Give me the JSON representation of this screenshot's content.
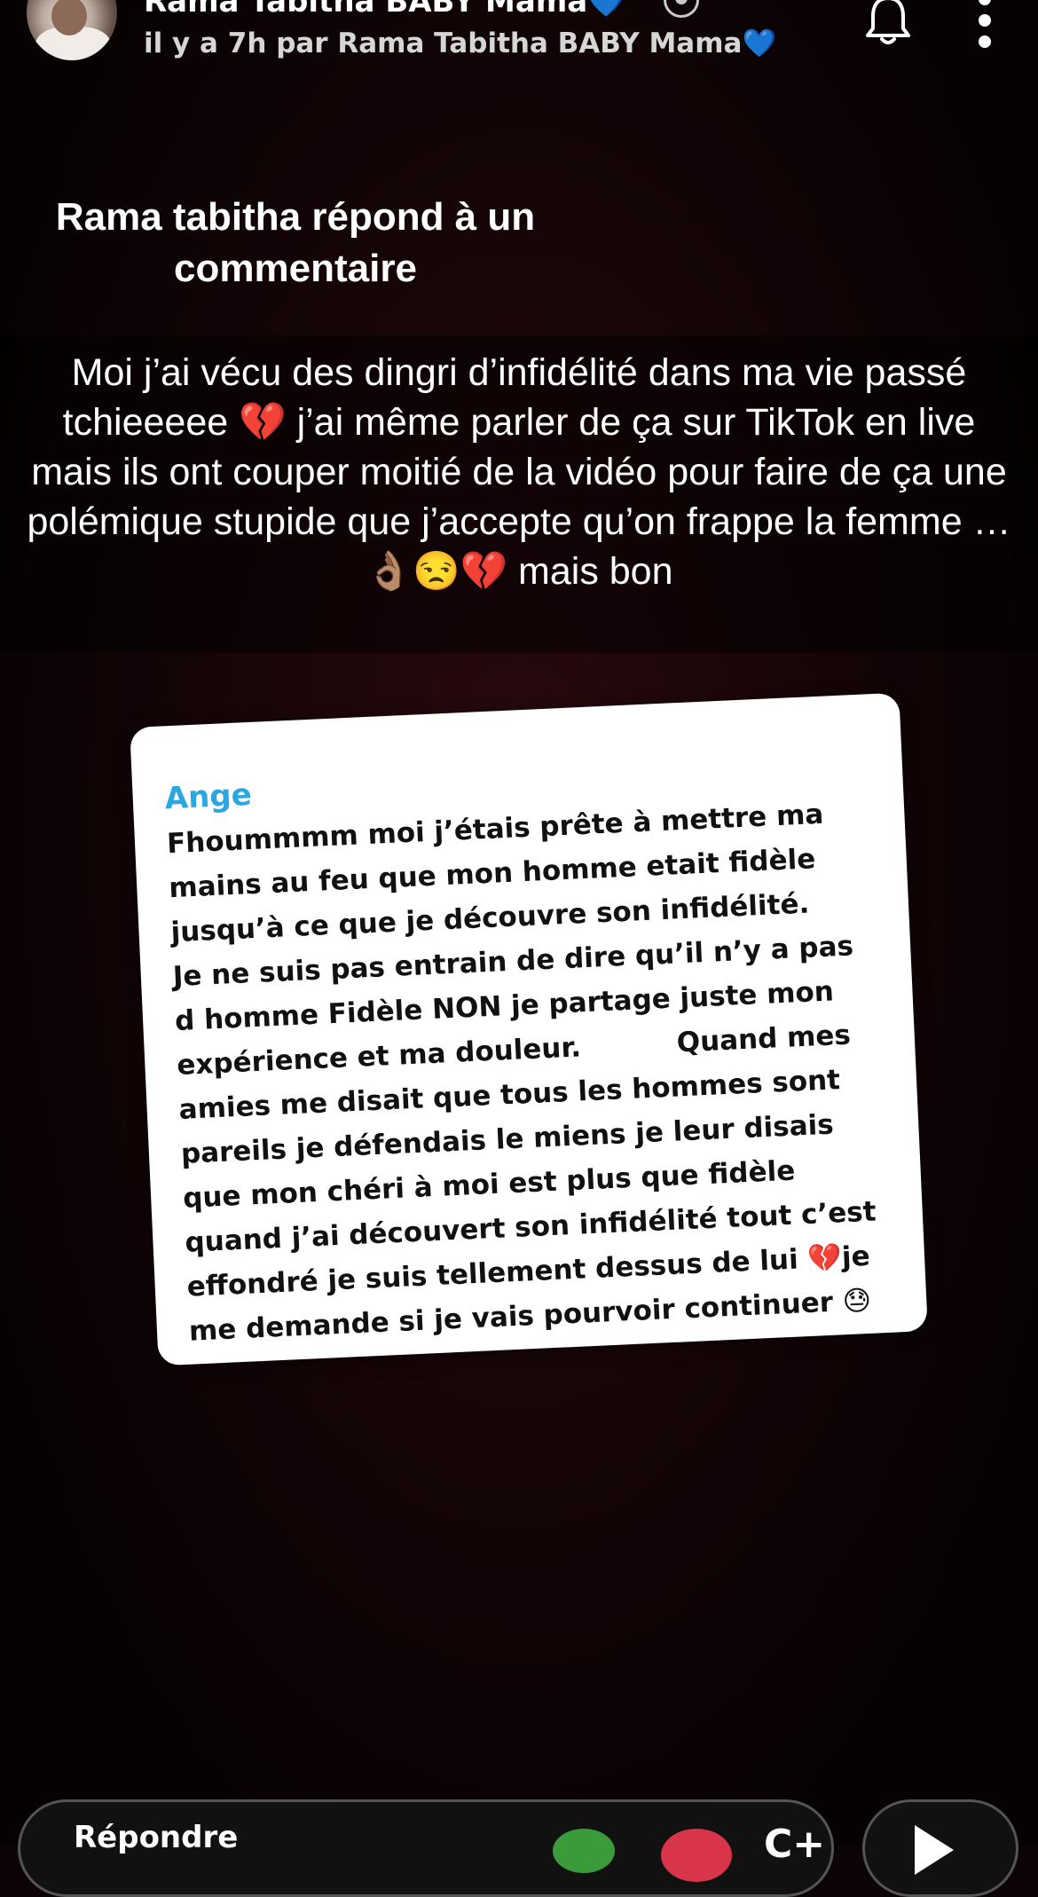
{
  "header": {
    "poster_name": "Rama Tabitha BABY Mama💙",
    "subtitle_prefix": "il y a 7h par Rama Tabitha BABY Mama",
    "subtitle_heart": "💙",
    "icons": [
      "avatar",
      "badge-icon",
      "bell-icon",
      "more-icon"
    ]
  },
  "caption_top": "Rama tabitha répond à un commentaire",
  "caption_main": "Moi j’ai vécu des dingri d’infidélité dans ma vie passé tchieeeee 💔 j’ai même parler de ça sur TikTok en live mais ils ont couper moitié de la vidéo pour faire de ça une polémique stupide que j’accepte qu’on frappe la femme … 👌🏽😒💔 mais bon",
  "comment": {
    "author": "Ange",
    "text": "Fhoummmm moi j’étais prête à mettre ma\nmains au feu que mon homme etait fidèle\njusqu’à ce que je découvre son infidélité.\nJe ne suis pas entrain de dire qu’il n’y a pas\nd homme Fidèle NON je partage juste mon\nexpérience et ma douleur.          Quand mes\namies me disait que tous les hommes sont\npareils je défendais le miens je leur disais\nque mon chéri à moi est plus que fidèle\nquand j’ai découvert son infidélité tout c’est\neffondré je suis tellement dessus de lui 💔je\nme demande si je vais pourvoir continuer 😓",
    "accent_color": "#2ba7e0"
  },
  "bottom_bar": {
    "reply_label": "Répondre",
    "icons": [
      "sticker-icon",
      "camera-icon",
      "add-friend-icon",
      "send-icon"
    ]
  }
}
